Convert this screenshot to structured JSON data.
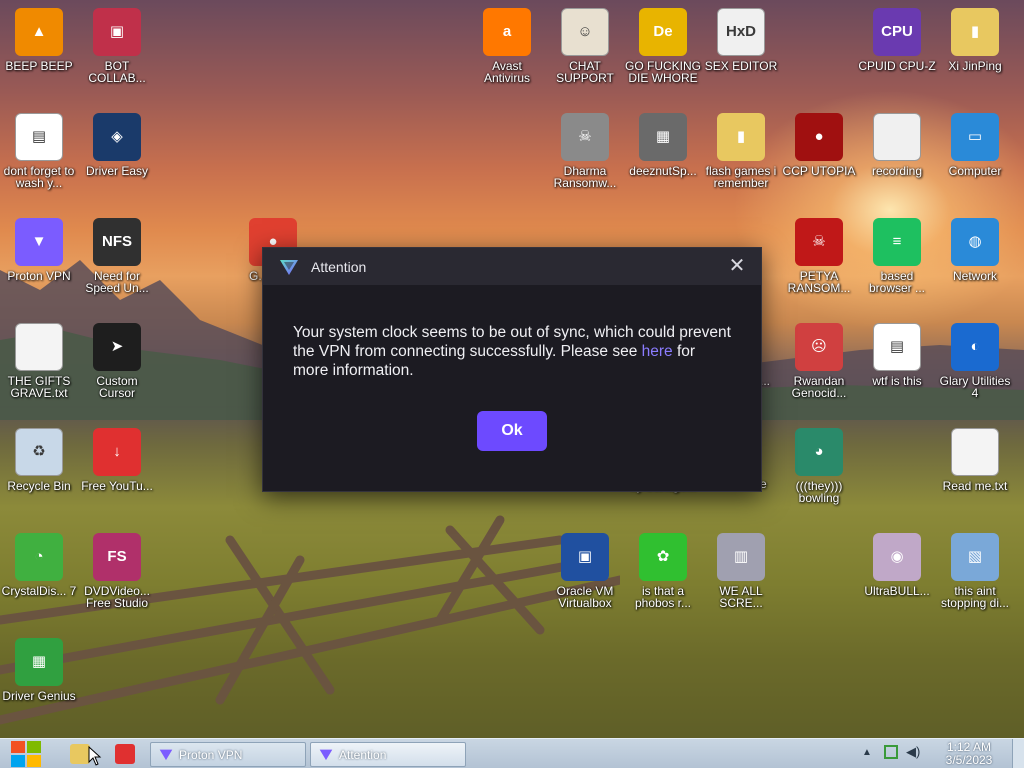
{
  "desktop": {
    "icons": [
      {
        "id": "beep-beep",
        "label": "BEEP BEEP",
        "icon": "vlc-cone-icon",
        "color": "#f08a00"
      },
      {
        "id": "bot-collab",
        "label": "BOT COLLAB...",
        "icon": "monitor-icon",
        "color": "#c0304a"
      },
      {
        "id": "avast",
        "label": "Avast Antivirus",
        "icon": "avast-icon",
        "color": "#ff7800"
      },
      {
        "id": "chat-support",
        "label": "CHAT SUPPORT",
        "icon": "doctor-icon",
        "color": "#e8e0d0"
      },
      {
        "id": "go-die",
        "label": "GO FUCKING DIE WHORE",
        "icon": "de-app-icon",
        "color": "#e8b400"
      },
      {
        "id": "sex-editor",
        "label": "SEX EDITOR",
        "icon": "hxd-icon",
        "color": "#f0f0f0"
      },
      {
        "id": "cpuid",
        "label": "CPUID CPU-Z",
        "icon": "cpuz-icon",
        "color": "#6a3ab0"
      },
      {
        "id": "xi-jinping",
        "label": "Xi JinPing",
        "icon": "folder-user-icon",
        "color": "#e8c860"
      },
      {
        "id": "dont-forget",
        "label": "dont forget to wash y...",
        "icon": "doc-icon",
        "color": "#ffffff"
      },
      {
        "id": "driver-easy",
        "label": "Driver Easy",
        "icon": "driver-easy-icon",
        "color": "#1a3a6a"
      },
      {
        "id": "dharma",
        "label": "Dharma Ransomw...",
        "icon": "skull-icon",
        "color": "#8a8a8a"
      },
      {
        "id": "deeznut",
        "label": "deeznutSp...",
        "icon": "stack-icon",
        "color": "#6a6a6a"
      },
      {
        "id": "flash-games",
        "label": "flash games i remember",
        "icon": "folder-icon",
        "color": "#e8c860"
      },
      {
        "id": "ccp",
        "label": "CCP UTOPIA",
        "icon": "red-circle-icon",
        "color": "#a01010"
      },
      {
        "id": "recording",
        "label": "recording",
        "icon": "blank-doc-icon",
        "color": "#f0f0f0"
      },
      {
        "id": "computer",
        "label": "Computer",
        "icon": "computer-icon",
        "color": "#2a8ad8"
      },
      {
        "id": "proton-vpn",
        "label": "Proton VPN",
        "icon": "proton-icon",
        "color": "#7b5cff"
      },
      {
        "id": "nfs",
        "label": "Need for Speed Un...",
        "icon": "nfs-icon",
        "color": "#303030"
      },
      {
        "id": "chrome",
        "label": "G... Ch...",
        "icon": "chrome-icon",
        "color": "#e04030"
      },
      {
        "id": "petya",
        "label": "PETYA RANSOM...",
        "icon": "skull-red-icon",
        "color": "#c01818"
      },
      {
        "id": "based",
        "label": "based browser ...",
        "icon": "chat-bubble-icon",
        "color": "#1ec060"
      },
      {
        "id": "network",
        "label": "Network",
        "icon": "network-icon",
        "color": "#2a8ad8"
      },
      {
        "id": "gifts",
        "label": "THE GIFTS GRAVE.txt",
        "icon": "txt-icon",
        "color": "#f4f4f4"
      },
      {
        "id": "cursor",
        "label": "Custom Cursor",
        "icon": "cursor-icon",
        "color": "#1e1e1e"
      },
      {
        "id": "rwandan",
        "label": "Rwandan Genocid...",
        "icon": "meme-icon",
        "color": "#d04040"
      },
      {
        "id": "wtf",
        "label": "wtf is this",
        "icon": "doc-icon",
        "color": "#ffffff"
      },
      {
        "id": "glary",
        "label": "Glary Utilities 4",
        "icon": "glary-icon",
        "color": "#1a6ad0"
      },
      {
        "id": "recycle",
        "label": "Recycle Bin",
        "icon": "recycle-bin-icon",
        "color": "#c8d8e8"
      },
      {
        "id": "free-yt",
        "label": "Free YouTu...",
        "icon": "download-icon",
        "color": "#e03030"
      },
      {
        "id": "transge",
        "label": "by transge...",
        "icon": "hidden-icon",
        "color": "#000000"
      },
      {
        "id": "they-bowling",
        "label": "(((they))) bowling",
        "icon": "bowling-icon",
        "color": "#2a8a6a"
      },
      {
        "id": "readme",
        "label": "Read me.txt",
        "icon": "txt-icon",
        "color": "#f4f4f4"
      },
      {
        "id": "crystal",
        "label": "CrystalDis... 7",
        "icon": "crystal-icon",
        "color": "#40b040"
      },
      {
        "id": "dvdvideo",
        "label": "DVDVideo... Free Studio",
        "icon": "fs-icon",
        "color": "#b0306a"
      },
      {
        "id": "vbox",
        "label": "Oracle VM Virtualbox",
        "icon": "virtualbox-icon",
        "color": "#2050a0"
      },
      {
        "id": "phobos",
        "label": "is that a phobos r...",
        "icon": "icq-icon",
        "color": "#30c030"
      },
      {
        "id": "we-all",
        "label": "WE ALL SCRE...",
        "icon": "old-pc-icon",
        "color": "#a0a0b0"
      },
      {
        "id": "ultrabull",
        "label": "UltraBULL...",
        "icon": "disc-icon",
        "color": "#c0a8c8"
      },
      {
        "id": "stopping",
        "label": "this aint stopping di...",
        "icon": "scanner-icon",
        "color": "#7aa8d8"
      },
      {
        "id": "driver-genius",
        "label": "Driver Genius",
        "icon": "circuit-icon",
        "color": "#30a040"
      }
    ],
    "partial_labels": {
      "g_suffix": "G",
      "de_suffix": "de",
      "dots": "..."
    }
  },
  "dialog": {
    "title": "Attention",
    "close_glyph": "✕",
    "message_before": "Your system clock seems to be out of sync, which could prevent the VPN from connecting successfully. Please see",
    "link_text": "here",
    "message_after": "for more information.",
    "ok_label": "Ok",
    "accent": "#6d4aff"
  },
  "taskbar": {
    "tasks": [
      {
        "label": "Proton VPN",
        "icon": "proton-icon"
      },
      {
        "label": "Attention",
        "icon": "proton-icon"
      }
    ],
    "clock_time": "1:12 AM",
    "clock_date": "3/5/2023",
    "tray_icons": [
      "show-hidden-icon",
      "network-tray-icon",
      "volume-icon"
    ]
  }
}
